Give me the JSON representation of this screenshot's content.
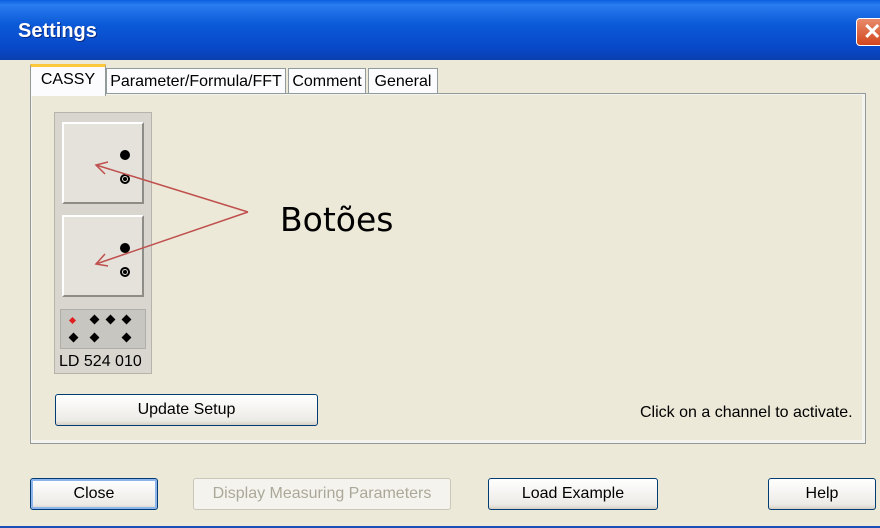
{
  "window": {
    "title": "Settings"
  },
  "tabs": [
    {
      "label": "CASSY",
      "active": true
    },
    {
      "label": "Parameter/Formula/FFT",
      "active": false
    },
    {
      "label": "Comment",
      "active": false
    },
    {
      "label": "General",
      "active": false
    }
  ],
  "device": {
    "label": "LD  524 010"
  },
  "annotation": {
    "text": "Botões",
    "color": "#c0504d"
  },
  "buttons": {
    "update_setup": "Update Setup",
    "close": "Close",
    "display_measuring_parameters": "Display Measuring Parameters",
    "load_example": "Load Example",
    "help": "Help"
  },
  "status": {
    "hint": "Click on a channel to activate."
  },
  "colors": {
    "titlebar": "#0b5ad8",
    "face": "#ece9d8",
    "close": "#d2461e"
  },
  "icons": {
    "close": "close-icon"
  }
}
